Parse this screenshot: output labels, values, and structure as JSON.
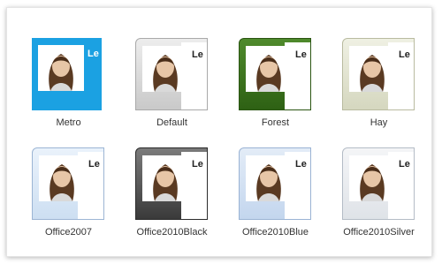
{
  "profile": {
    "name_fragment": "Le"
  },
  "skins": [
    {
      "label": "Metro"
    },
    {
      "label": "Default"
    },
    {
      "label": "Forest"
    },
    {
      "label": "Hay"
    },
    {
      "label": "Office2007"
    },
    {
      "label": "Office2010Black"
    },
    {
      "label": "Office2010Blue"
    },
    {
      "label": "Office2010Silver"
    }
  ],
  "colors": {
    "metro": "#1ba1e2",
    "forest": "#2e6114",
    "hay": "#d5d7bf",
    "office2010black": "#3a3a3a"
  }
}
